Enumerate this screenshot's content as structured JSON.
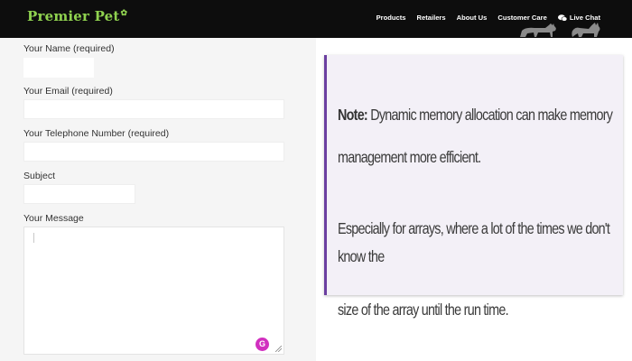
{
  "header": {
    "logo": "Premier Pet",
    "nav": [
      "Products",
      "Retailers",
      "About Us",
      "Customer Care"
    ],
    "live_chat": "Live Chat"
  },
  "form": {
    "name_label": "Your Name (required)",
    "email_label": "Your Email (required)",
    "phone_label": "Your Telephone Number (required)",
    "subject_label": "Subject",
    "message_label": "Your Message",
    "name_value": "",
    "email_value": "",
    "phone_value": "",
    "subject_value": "",
    "message_value": ""
  },
  "note": {
    "prefix": "Note:",
    "line1": " Dynamic memory allocation can make memory",
    "line2": "management more efficient.",
    "line3": "Especially for arrays, where a lot of the times we don't know the",
    "line4": "size of the array until the run time."
  },
  "colors": {
    "header_bg": "#0d0d0d",
    "logo_green": "#8fd14f",
    "note_border": "#6b3fa0",
    "grammarly": "#d12fbf"
  }
}
